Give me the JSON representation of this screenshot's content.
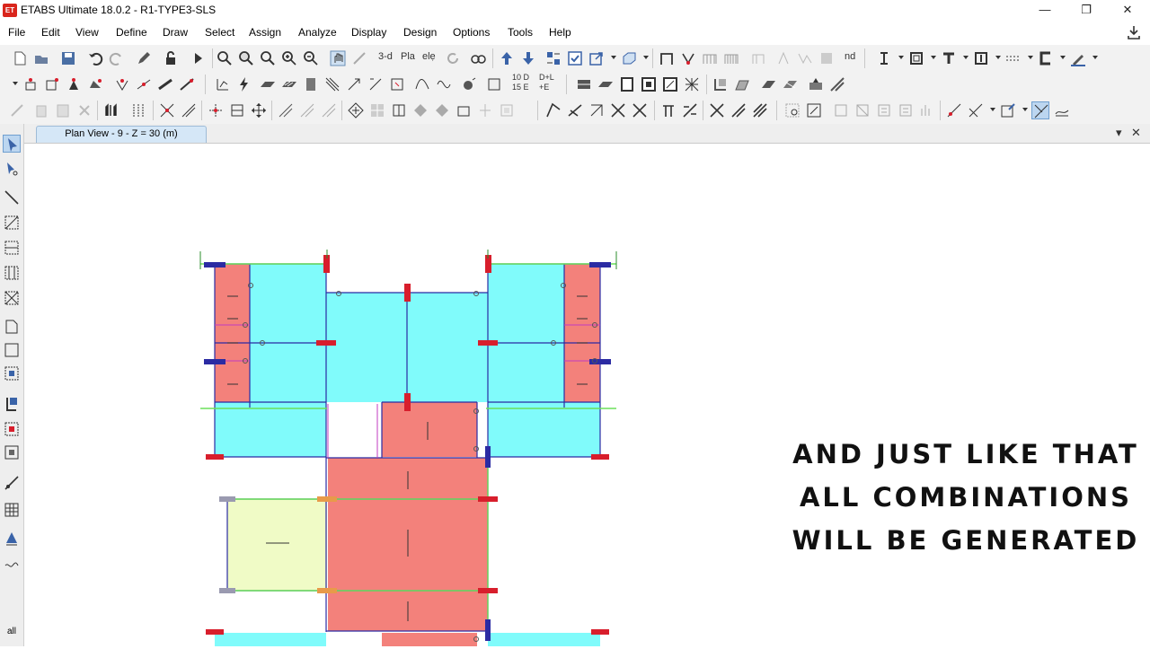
{
  "app": {
    "icon_label": "ET",
    "title": "ETABS Ultimate 18.0.2 - R1-TYPE3-SLS"
  },
  "window_controls": {
    "minimize": "—",
    "restore": "❐",
    "close": "✕"
  },
  "menu": [
    "File",
    "Edit",
    "View",
    "Define",
    "Draw",
    "Select",
    "Assign",
    "Analyze",
    "Display",
    "Design",
    "Options",
    "Tools",
    "Help"
  ],
  "toolbar": {
    "view_3d": "3-d",
    "view_plan": "Plа",
    "view_elev": "elẹ",
    "labels_nd": "nd",
    "combo_10d": "10 D",
    "combo_15e": "15 E",
    "combo_dl": "D+L",
    "combo_e": "+E"
  },
  "view_tab": {
    "title": "Plan View - 9 - Z = 30 (m)",
    "dropdown": "▾",
    "close": "✕"
  },
  "left_toolbar": {
    "all_label": "all"
  },
  "overlay": {
    "line1": "AND JUST LIKE THAT",
    "line2": "ALL COMBINATIONS",
    "line3": "WILL BE GENERATED"
  },
  "colors": {
    "slab_cyan": "#80fbfb",
    "slab_red": "#f3817b",
    "slab_yellow": "#f0fbc6",
    "beam_blue": "#2b2ba3",
    "column_red": "#d81e2c",
    "wall_green": "#6be05b",
    "accent_tab": "#d5e7f7"
  }
}
